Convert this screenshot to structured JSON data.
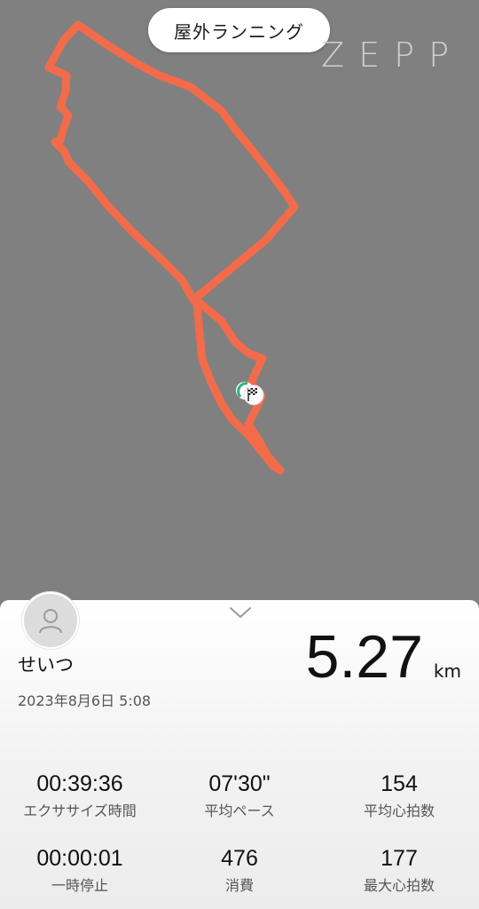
{
  "header": {
    "activity_title": "屋外ランニング",
    "brand": "ZEPP"
  },
  "map": {
    "route_color": "#f26b4a",
    "background_color": "#808080",
    "start_marker_icon": "start-marker-icon",
    "finish_marker_icon": "checkered-flag-icon"
  },
  "summary": {
    "user_name": "せいつ",
    "date_time": "2023年8月6日 5:08",
    "distance_value": "5.27",
    "distance_unit": "km",
    "collapse_icon": "chevron-down-icon",
    "avatar_icon": "person-icon"
  },
  "stats": [
    {
      "value": "00:39:36",
      "label": "エクササイズ時間"
    },
    {
      "value": "07'30\"",
      "label": "平均ペース"
    },
    {
      "value": "154",
      "label": "平均心拍数"
    },
    {
      "value": "00:00:01",
      "label": "一時停止"
    },
    {
      "value": "476",
      "label": "消費"
    },
    {
      "value": "177",
      "label": "最大心拍数"
    }
  ]
}
